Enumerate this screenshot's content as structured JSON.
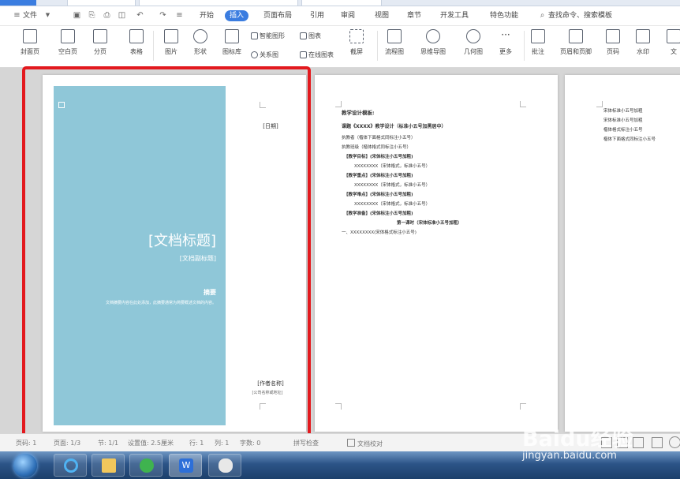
{
  "menu": {
    "file": "文件",
    "tabs": [
      "开始",
      "插入",
      "页面布局",
      "引用",
      "审阅",
      "视图",
      "章节",
      "开发工具",
      "特色功能"
    ],
    "active_tab": "插入",
    "search": "查找命令、搜索模板"
  },
  "ribbon": {
    "items": [
      "封面页",
      "空白页",
      "分页",
      "表格",
      "图片",
      "形状",
      "图标库",
      "流程图",
      "思维导图",
      "几何图",
      "更多",
      "批注",
      "页眉和页脚",
      "页码",
      "水印",
      "文"
    ],
    "small": [
      "智能图形",
      "图表",
      "关系图",
      "在线图表",
      "截屏"
    ]
  },
  "cover": {
    "date": "[日期]",
    "title": "[文档标题]",
    "subtitle": "[文档副标题]",
    "abstract_label": "摘要",
    "abstract_text": "文档摘要内容在此处添加，此摘要通常为简要概述文档的内容。",
    "author": "[作者名称]",
    "company": "[公司名称或地址]"
  },
  "page2": {
    "lines": [
      "教学设计模板:",
      "课题《XXXX》教学设计（标准小五号加黑居中）",
      "执教者（楷体下面格式同标注小五号）",
      "执教班级（楷体格式同标注小五号）",
      "【教学目标】(宋体标注小五号加粗)",
      "XXXXXXXX（宋体格式，标准小五号）",
      "【教学重点】(宋体标注小五号加粗)",
      "XXXXXXXX（宋体格式，标准小五号）",
      "【教学难点】(宋体标注小五号加粗)",
      "XXXXXXXX（宋体格式，标准小五号）",
      "【教学准备】(宋体标注小五号加粗)",
      "第一课时（宋体标准小五号加粗）",
      "一、XXXXXXXX(宋体格式标注小五号)"
    ]
  },
  "page3": {
    "lines": [
      "宋体标准小五号加粗",
      "宋体标准小五号加粗",
      "楷体格式标注小五号",
      "楷体下面格式同标注小五号"
    ]
  },
  "status": {
    "items": [
      "页码: 1",
      "页面: 1/3",
      "节: 1/1",
      "设置值: 2.5厘米",
      "行: 1",
      "列: 1",
      "字数: 0",
      "拼写检查",
      "文档校对"
    ]
  },
  "watermark": {
    "brand": "Baidu经验",
    "url": "jingyan.baidu.com"
  },
  "colors": {
    "accent": "#3b7de0",
    "cover_bg": "#8fc7d8",
    "highlight": "#e3191e"
  }
}
